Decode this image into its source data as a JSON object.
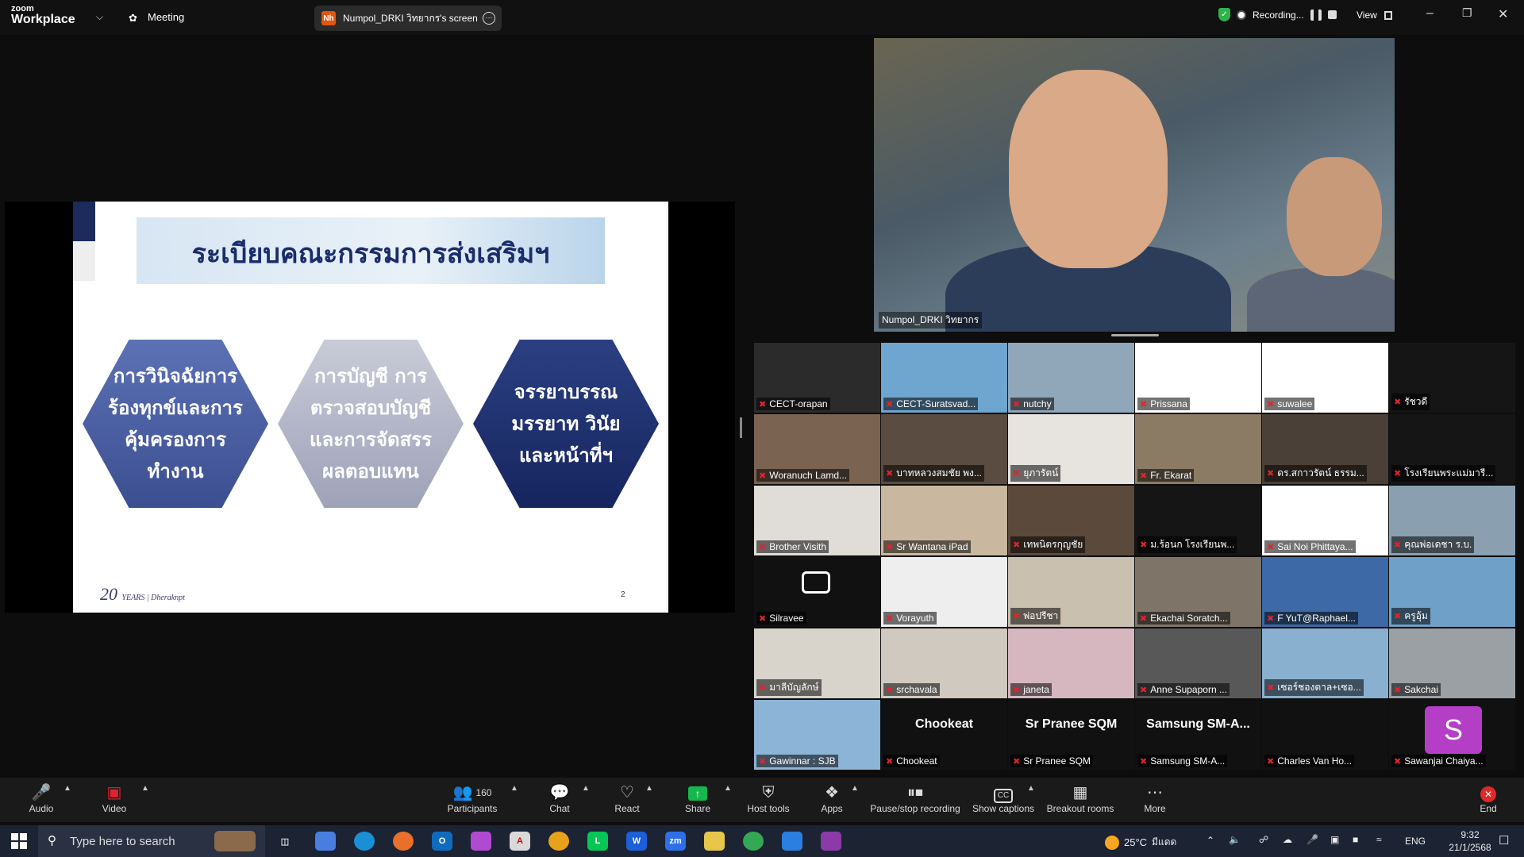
{
  "app": {
    "logo_line1": "zoom",
    "logo_line2": "Workplace",
    "meeting_label": "Meeting"
  },
  "share_pill": {
    "initials": "Nh",
    "label": "Numpol_DRKI วิทยากร's screen"
  },
  "recording": {
    "label": "Recording..."
  },
  "view_label": "View",
  "slide": {
    "title": "ระเบียบคณะกรรมการส่งเสริมฯ",
    "hex1": "การวินิจฉัยการร้องทุกข์และการคุ้มครองการทำงาน",
    "hex2": "การบัญชี การตรวจสอบบัญชี และการจัดสรรผลตอบแทน",
    "hex3": "จรรยาบรรณ มรรยาท วินัยและหน้าที่ฯ",
    "logo": "20",
    "logo_sub": "YEARS | Dheraknpt",
    "number": "2"
  },
  "speaker": {
    "name": "Numpol_DRKI วิทยากร"
  },
  "gallery": [
    {
      "name": "CECT-orapan"
    },
    {
      "name": "CECT-Suratsvad..."
    },
    {
      "name": "nutchy"
    },
    {
      "name": "Prissana"
    },
    {
      "name": "suwalee"
    },
    {
      "name": "รัชวดี"
    },
    {
      "name": "Woranuch Lamd..."
    },
    {
      "name": "บาทหลวงสมชัย พง..."
    },
    {
      "name": "ยุภารัตน์"
    },
    {
      "name": "Fr. Ekarat"
    },
    {
      "name": "ดร.สกาวรัตน์ ธรรม..."
    },
    {
      "name": "โรงเรียนพระแม่มารี..."
    },
    {
      "name": "Brother Visith"
    },
    {
      "name": "Sr Wantana iPad"
    },
    {
      "name": "เทพนิตรกุญชัย"
    },
    {
      "name": "ม.ร้อนก โรงเรียนพ..."
    },
    {
      "name": "Sai Noi Phittaya..."
    },
    {
      "name": "คุณพ่อเดชา ร.บ."
    },
    {
      "name": "Silravee"
    },
    {
      "name": "Vorayuth"
    },
    {
      "name": "พ่อปรีชา"
    },
    {
      "name": "Ekachai Soratch..."
    },
    {
      "name": "F YuT@Raphael..."
    },
    {
      "name": "ครูอุ้ม"
    },
    {
      "name": "มาลีบัญลักษ์"
    },
    {
      "name": "srchavala"
    },
    {
      "name": "janeta"
    },
    {
      "name": "Anne Supaporn ..."
    },
    {
      "name": "เซอร์ชองตาล+เซอ..."
    },
    {
      "name": "Sakchai"
    },
    {
      "name": "Gawinnar : SJB"
    },
    {
      "name": "Chookeat",
      "big": "Chookeat"
    },
    {
      "name": "Sr Pranee SQM",
      "big": "Sr Pranee SQM"
    },
    {
      "name": "Samsung SM-A...",
      "big": "Samsung  SM-A..."
    },
    {
      "name": "Charles Van Ho..."
    },
    {
      "name": "Sawanjai Chaiya...",
      "avatar": "S"
    }
  ],
  "toolbar": {
    "audio": "Audio",
    "video": "Video",
    "participants": "Participants",
    "participants_count": "160",
    "chat": "Chat",
    "react": "React",
    "share": "Share",
    "host_tools": "Host tools",
    "apps": "Apps",
    "pause_rec": "Pause/stop recording",
    "captions": "Show captions",
    "breakout": "Breakout rooms",
    "more": "More",
    "end": "End"
  },
  "taskbar": {
    "search_placeholder": "Type here to search",
    "temp": "25°C",
    "weather": "มีแดด",
    "lang": "ENG",
    "time": "9:32",
    "date": "21/1/2568"
  },
  "colors": {
    "accent": "#0b5cff",
    "mic_muted": "#e0242e",
    "share_green": "#14b84c",
    "end_red": "#e02828"
  }
}
